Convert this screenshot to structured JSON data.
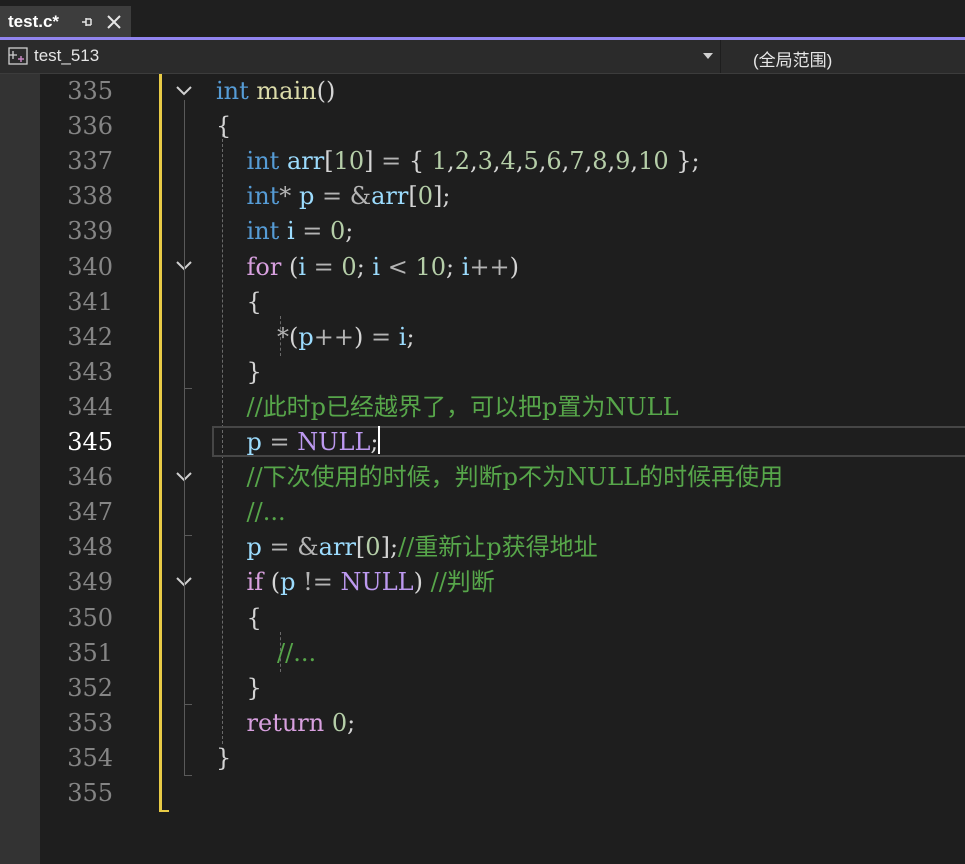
{
  "tab": {
    "title": "test.c*"
  },
  "nav": {
    "project": "test_513",
    "scope": "(全局范围)"
  },
  "editor": {
    "current_line": "345",
    "line_numbers": [
      "335",
      "336",
      "337",
      "338",
      "339",
      "340",
      "341",
      "342",
      "343",
      "344",
      "345",
      "346",
      "347",
      "348",
      "349",
      "350",
      "351",
      "352",
      "353",
      "354",
      "355"
    ],
    "lines": [
      [
        [
          "kw",
          "int"
        ],
        [
          "p",
          " "
        ],
        [
          "fn",
          "main"
        ],
        [
          "p",
          "()"
        ]
      ],
      [
        [
          "p",
          "{"
        ]
      ],
      [
        [
          "p",
          "    "
        ],
        [
          "kw",
          "int"
        ],
        [
          "p",
          " "
        ],
        [
          "var",
          "arr"
        ],
        [
          "p",
          "["
        ],
        [
          "num",
          "10"
        ],
        [
          "p",
          "] "
        ],
        [
          "op",
          "="
        ],
        [
          "p",
          " { "
        ],
        [
          "num",
          "1"
        ],
        [
          "p",
          ","
        ],
        [
          "num",
          "2"
        ],
        [
          "p",
          ","
        ],
        [
          "num",
          "3"
        ],
        [
          "p",
          ","
        ],
        [
          "num",
          "4"
        ],
        [
          "p",
          ","
        ],
        [
          "num",
          "5"
        ],
        [
          "p",
          ","
        ],
        [
          "num",
          "6"
        ],
        [
          "p",
          ","
        ],
        [
          "num",
          "7"
        ],
        [
          "p",
          ","
        ],
        [
          "num",
          "8"
        ],
        [
          "p",
          ","
        ],
        [
          "num",
          "9"
        ],
        [
          "p",
          ","
        ],
        [
          "num",
          "10"
        ],
        [
          "p",
          " };"
        ]
      ],
      [
        [
          "p",
          "    "
        ],
        [
          "kw",
          "int"
        ],
        [
          "op",
          "*"
        ],
        [
          "p",
          " "
        ],
        [
          "var",
          "p"
        ],
        [
          "p",
          " "
        ],
        [
          "op",
          "="
        ],
        [
          "p",
          " "
        ],
        [
          "op",
          "&"
        ],
        [
          "var",
          "arr"
        ],
        [
          "p",
          "["
        ],
        [
          "num",
          "0"
        ],
        [
          "p",
          "];"
        ]
      ],
      [
        [
          "p",
          "    "
        ],
        [
          "kw",
          "int"
        ],
        [
          "p",
          " "
        ],
        [
          "var",
          "i"
        ],
        [
          "p",
          " "
        ],
        [
          "op",
          "="
        ],
        [
          "p",
          " "
        ],
        [
          "num",
          "0"
        ],
        [
          "p",
          ";"
        ]
      ],
      [
        [
          "p",
          "    "
        ],
        [
          "ctrl",
          "for"
        ],
        [
          "p",
          " ("
        ],
        [
          "var",
          "i"
        ],
        [
          "p",
          " "
        ],
        [
          "op",
          "="
        ],
        [
          "p",
          " "
        ],
        [
          "num",
          "0"
        ],
        [
          "p",
          "; "
        ],
        [
          "var",
          "i"
        ],
        [
          "p",
          " "
        ],
        [
          "op",
          "<"
        ],
        [
          "p",
          " "
        ],
        [
          "num",
          "10"
        ],
        [
          "p",
          "; "
        ],
        [
          "var",
          "i"
        ],
        [
          "op",
          "++"
        ],
        [
          "p",
          ")"
        ]
      ],
      [
        [
          "p",
          "    {"
        ]
      ],
      [
        [
          "p",
          "        "
        ],
        [
          "op",
          "*"
        ],
        [
          "p",
          "("
        ],
        [
          "var",
          "p"
        ],
        [
          "op",
          "++"
        ],
        [
          "p",
          ") "
        ],
        [
          "op",
          "="
        ],
        [
          "p",
          " "
        ],
        [
          "var",
          "i"
        ],
        [
          "p",
          ";"
        ]
      ],
      [
        [
          "p",
          "    }"
        ]
      ],
      [
        [
          "p",
          "    "
        ],
        [
          "cmt",
          "//此时p已经越界了，可以把p置为NULL"
        ]
      ],
      [
        [
          "p",
          "    "
        ],
        [
          "var",
          "p"
        ],
        [
          "p",
          " "
        ],
        [
          "op",
          "="
        ],
        [
          "p",
          " "
        ],
        [
          "macro",
          "NULL"
        ],
        [
          "p",
          ";"
        ]
      ],
      [
        [
          "p",
          "    "
        ],
        [
          "cmt",
          "//下次使用的时候，判断p不为NULL的时候再使用"
        ]
      ],
      [
        [
          "p",
          "    "
        ],
        [
          "cmt",
          "//..."
        ]
      ],
      [
        [
          "p",
          "    "
        ],
        [
          "var",
          "p"
        ],
        [
          "p",
          " "
        ],
        [
          "op",
          "="
        ],
        [
          "p",
          " "
        ],
        [
          "op",
          "&"
        ],
        [
          "var",
          "arr"
        ],
        [
          "p",
          "["
        ],
        [
          "num",
          "0"
        ],
        [
          "p",
          "];"
        ],
        [
          "cmt",
          "//重新让p获得地址"
        ]
      ],
      [
        [
          "p",
          "    "
        ],
        [
          "ctrl",
          "if"
        ],
        [
          "p",
          " ("
        ],
        [
          "var",
          "p"
        ],
        [
          "p",
          " "
        ],
        [
          "op",
          "!="
        ],
        [
          "p",
          " "
        ],
        [
          "macro",
          "NULL"
        ],
        [
          "p",
          ") "
        ],
        [
          "cmt",
          "//判断"
        ]
      ],
      [
        [
          "p",
          "    {"
        ]
      ],
      [
        [
          "p",
          "        "
        ],
        [
          "cmt",
          "//..."
        ]
      ],
      [
        [
          "p",
          "    }"
        ]
      ],
      [
        [
          "p",
          "    "
        ],
        [
          "ctrl",
          "return"
        ],
        [
          "p",
          " "
        ],
        [
          "num",
          "0"
        ],
        [
          "p",
          ";"
        ]
      ],
      [
        [
          "p",
          "}"
        ]
      ],
      []
    ]
  }
}
